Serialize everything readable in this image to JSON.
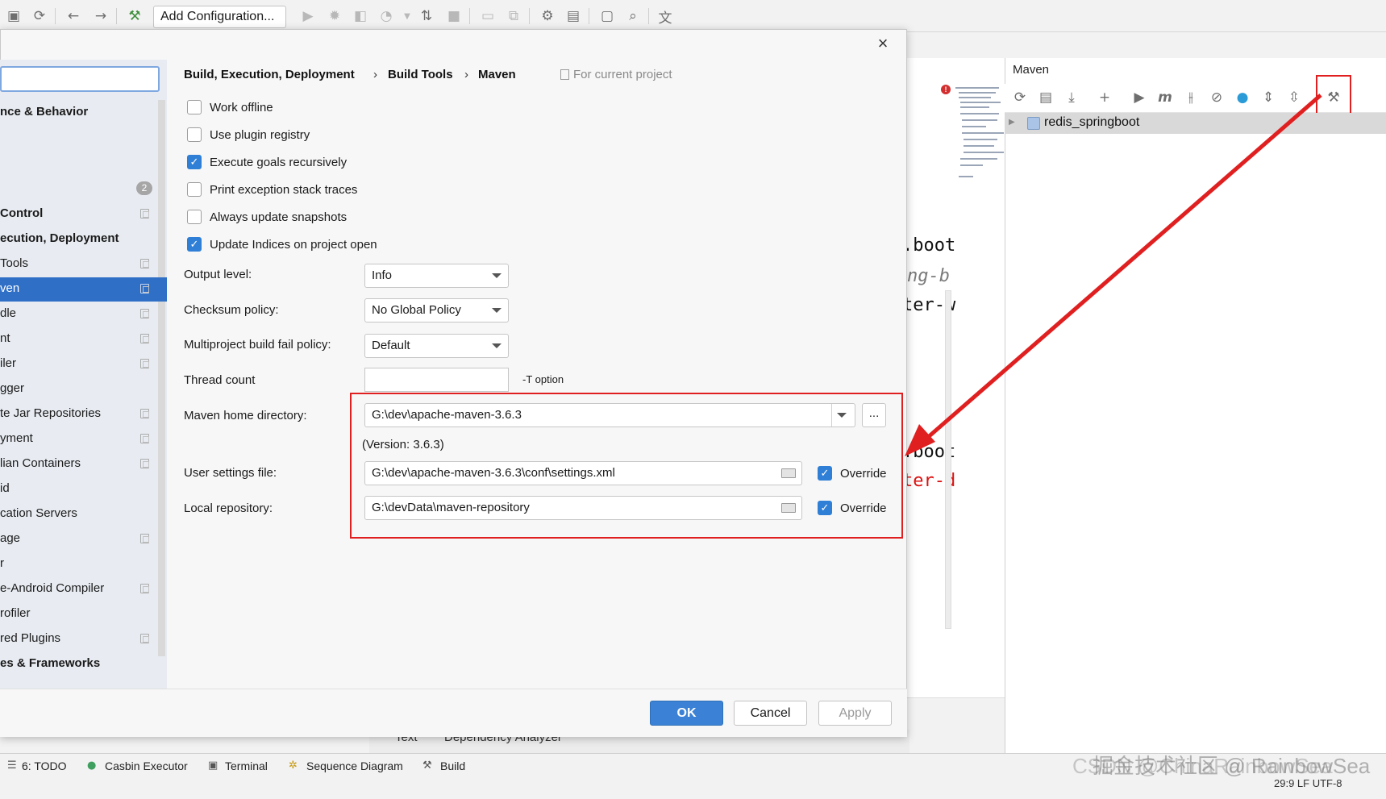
{
  "toolbar": {
    "add_configuration": "Add Configuration..."
  },
  "dialog": {
    "breadcrumb": [
      "Build, Execution, Deployment",
      "Build Tools",
      "Maven"
    ],
    "breadcrumb_sep": "›",
    "for_current_project": "For current project",
    "close_symbol": "×",
    "nav": {
      "items": [
        "nce & Behavior",
        "Control",
        "ecution, Deployment",
        "Tools",
        "ven",
        "dle",
        "nt",
        "iler",
        "gger",
        "te Jar Repositories",
        "yment",
        "lian Containers",
        "id",
        "cation Servers",
        "age",
        "r",
        "e-Android Compiler",
        "rofiler",
        "red Plugins",
        "es & Frameworks"
      ],
      "badge": "2"
    },
    "checkboxes": [
      {
        "label": "Work offline",
        "checked": false
      },
      {
        "label": "Use plugin registry",
        "checked": false
      },
      {
        "label": "Execute goals recursively",
        "checked": true
      },
      {
        "label": "Print exception stack traces",
        "checked": false
      },
      {
        "label": "Always update snapshots",
        "checked": false
      },
      {
        "label": "Update Indices on project open",
        "checked": true
      }
    ],
    "output_level": {
      "label": "Output level:",
      "value": "Info"
    },
    "checksum_policy": {
      "label": "Checksum policy:",
      "value": "No Global Policy"
    },
    "fail_policy": {
      "label": "Multiproject build fail policy:",
      "value": "Default"
    },
    "thread_count": {
      "label": "Thread count",
      "value": "",
      "hint": "-T option"
    },
    "maven_home": {
      "label": "Maven home directory:",
      "value": "G:\\dev\\apache-maven-3.6.3",
      "browse": "...",
      "version": "(Version: 3.6.3)"
    },
    "user_settings": {
      "label": "User settings file:",
      "value": "G:\\dev\\apache-maven-3.6.3\\conf\\settings.xml",
      "override_label": "Override",
      "override": true
    },
    "local_repo": {
      "label": "Local repository:",
      "value": "G:\\devData\\maven-repository",
      "override_label": "Override",
      "override": true
    },
    "buttons": {
      "ok": "OK",
      "cancel": "Cancel",
      "apply": "Apply"
    }
  },
  "maven_panel": {
    "title": "Maven",
    "project": "redis_springboot"
  },
  "editor": {
    "lines": [
      ".boot",
      "ng-b",
      "ter-w",
      ".boot",
      "ter-d"
    ]
  },
  "bottom": {
    "tabs_under": [
      "Text",
      "Dependency Analyzer"
    ],
    "items": [
      "6: TODO",
      "Casbin Executor",
      "Terminal",
      "Sequence Diagram",
      "Build"
    ],
    "status": "29:9   LF   UTF-8",
    "watermark": "掘金技术社区 @ RainbowSea",
    "watermark2": "CSDN @ChinaRainbowSea"
  },
  "colors": {
    "accent": "#2f6fc6",
    "highlight_red": "#e02020",
    "checkbox_blue": "#2f7fd6",
    "ok_button": "#3b82d6"
  }
}
